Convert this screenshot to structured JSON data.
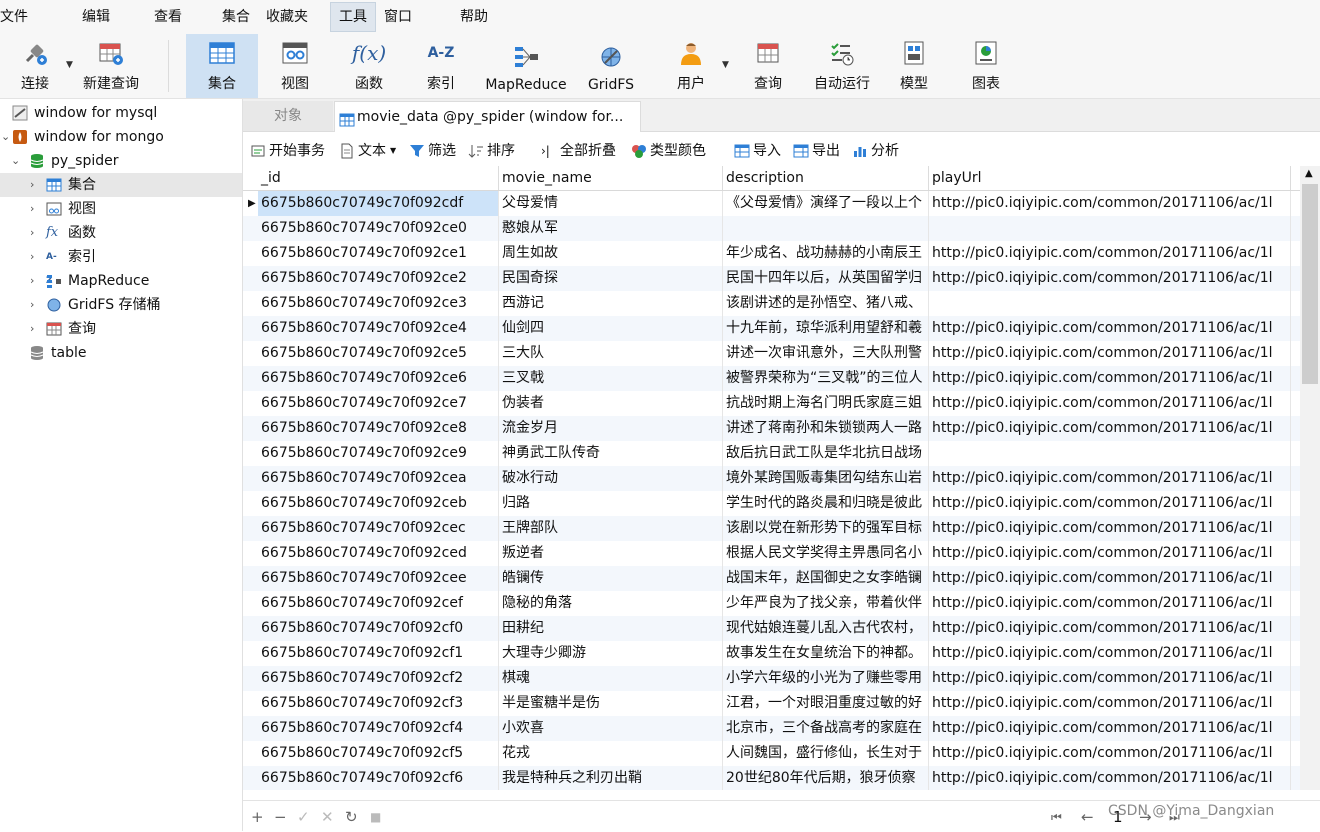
{
  "menu": [
    "文件",
    "编辑",
    "查看",
    "集合",
    "收藏夹",
    "工具",
    "窗口",
    "帮助"
  ],
  "toolbar": {
    "connect": "连接",
    "new_query": "新建查询",
    "collection": "集合",
    "view": "视图",
    "function": "函数",
    "index": "索引",
    "mapreduce": "MapReduce",
    "gridfs": "GridFS",
    "user": "用户",
    "query": "查询",
    "autorun": "自动运行",
    "model": "模型",
    "chart": "图表"
  },
  "sidebar": {
    "conn_mysql": "window for mysql",
    "conn_mongo": "window for mongo",
    "db": "py_spider",
    "items": [
      "集合",
      "视图",
      "函数",
      "索引",
      "MapReduce",
      "GridFS 存储桶",
      "查询"
    ],
    "table": "table"
  },
  "tabs": {
    "objects": "对象",
    "current": "movie_data @py_spider (window for..."
  },
  "subtoolbar": {
    "begin_tx": "开始事务",
    "text": "文本",
    "filter": "筛选",
    "sort": "排序",
    "collapse": "全部折叠",
    "type_color": "类型颜色",
    "import": "导入",
    "export": "导出",
    "analyze": "分析"
  },
  "grid": {
    "columns": [
      "_id",
      "movie_name",
      "description",
      "playUrl"
    ],
    "rows": [
      [
        "6675b860c70749c70f092cdf",
        "父母爱情",
        "《父母爱情》演绎了一段以上个",
        "http://pic0.iqiyipic.com/common/20171106/ac/1l"
      ],
      [
        "6675b860c70749c70f092ce0",
        "憨娘从军",
        "",
        ""
      ],
      [
        "6675b860c70749c70f092ce1",
        "周生如故",
        "年少成名、战功赫赫的小南辰王",
        "http://pic0.iqiyipic.com/common/20171106/ac/1l"
      ],
      [
        "6675b860c70749c70f092ce2",
        "民国奇探",
        "民国十四年以后，从英国留学归",
        "http://pic0.iqiyipic.com/common/20171106/ac/1l"
      ],
      [
        "6675b860c70749c70f092ce3",
        "西游记",
        "该剧讲述的是孙悟空、猪八戒、",
        ""
      ],
      [
        "6675b860c70749c70f092ce4",
        "仙剑四",
        "十九年前，琼华派利用望舒和羲",
        "http://pic0.iqiyipic.com/common/20171106/ac/1l"
      ],
      [
        "6675b860c70749c70f092ce5",
        "三大队",
        "讲述一次审讯意外，三大队刑警",
        "http://pic0.iqiyipic.com/common/20171106/ac/1l"
      ],
      [
        "6675b860c70749c70f092ce6",
        "三叉戟",
        "被警界荣称为“三叉戟”的三位人",
        "http://pic0.iqiyipic.com/common/20171106/ac/1l"
      ],
      [
        "6675b860c70749c70f092ce7",
        "伪装者",
        "抗战时期上海名门明氏家庭三姐",
        "http://pic0.iqiyipic.com/common/20171106/ac/1l"
      ],
      [
        "6675b860c70749c70f092ce8",
        "流金岁月",
        "讲述了蒋南孙和朱锁锁两人一路",
        "http://pic0.iqiyipic.com/common/20171106/ac/1l"
      ],
      [
        "6675b860c70749c70f092ce9",
        "神勇武工队传奇",
        "敌后抗日武工队是华北抗日战场",
        ""
      ],
      [
        "6675b860c70749c70f092cea",
        "破冰行动",
        "境外某跨国贩毒集团勾结东山岩",
        "http://pic0.iqiyipic.com/common/20171106/ac/1l"
      ],
      [
        "6675b860c70749c70f092ceb",
        "归路",
        "学生时代的路炎晨和归晓是彼此",
        "http://pic0.iqiyipic.com/common/20171106/ac/1l"
      ],
      [
        "6675b860c70749c70f092cec",
        "王牌部队",
        "该剧以党在新形势下的强军目标",
        "http://pic0.iqiyipic.com/common/20171106/ac/1l"
      ],
      [
        "6675b860c70749c70f092ced",
        "叛逆者",
        "根据人民文学奖得主畀愚同名小",
        "http://pic0.iqiyipic.com/common/20171106/ac/1l"
      ],
      [
        "6675b860c70749c70f092cee",
        "皓镧传",
        "战国末年，赵国御史之女李皓镧",
        "http://pic0.iqiyipic.com/common/20171106/ac/1l"
      ],
      [
        "6675b860c70749c70f092cef",
        "隐秘的角落",
        "少年严良为了找父亲，带着伙伴",
        "http://pic0.iqiyipic.com/common/20171106/ac/1l"
      ],
      [
        "6675b860c70749c70f092cf0",
        "田耕纪",
        "现代姑娘连蔓儿乱入古代农村，",
        "http://pic0.iqiyipic.com/common/20171106/ac/1l"
      ],
      [
        "6675b860c70749c70f092cf1",
        "大理寺少卿游",
        "故事发生在女皇统治下的神都。",
        "http://pic0.iqiyipic.com/common/20171106/ac/1l"
      ],
      [
        "6675b860c70749c70f092cf2",
        "棋魂",
        "小学六年级的小光为了赚些零用",
        "http://pic0.iqiyipic.com/common/20171106/ac/1l"
      ],
      [
        "6675b860c70749c70f092cf3",
        "半是蜜糖半是伤",
        "江君，一个对眼泪重度过敏的好",
        "http://pic0.iqiyipic.com/common/20171106/ac/1l"
      ],
      [
        "6675b860c70749c70f092cf4",
        "小欢喜",
        "北京市，三个备战高考的家庭在",
        "http://pic0.iqiyipic.com/common/20171106/ac/1l"
      ],
      [
        "6675b860c70749c70f092cf5",
        "花戎",
        "人间魏国，盛行修仙，长生对于",
        "http://pic0.iqiyipic.com/common/20171106/ac/1l"
      ],
      [
        "6675b860c70749c70f092cf6",
        "我是特种兵之利刃出鞘",
        "20世纪80年代后期，狼牙侦察",
        "http://pic0.iqiyipic.com/common/20171106/ac/1l"
      ]
    ]
  },
  "statusbar": {
    "add": "+",
    "remove": "−",
    "apply": "✓",
    "discard": "✕",
    "refresh": "↻",
    "stop": "■",
    "first": "⏮",
    "prev": "←",
    "page": "1",
    "next": "→",
    "last": "⏭"
  },
  "watermark": "CSDN @Yima_Dangxian",
  "colors": {
    "accent": "#cfe1f3",
    "selected_row": "#cde3f9",
    "alt_row": "#f3f7fc"
  }
}
